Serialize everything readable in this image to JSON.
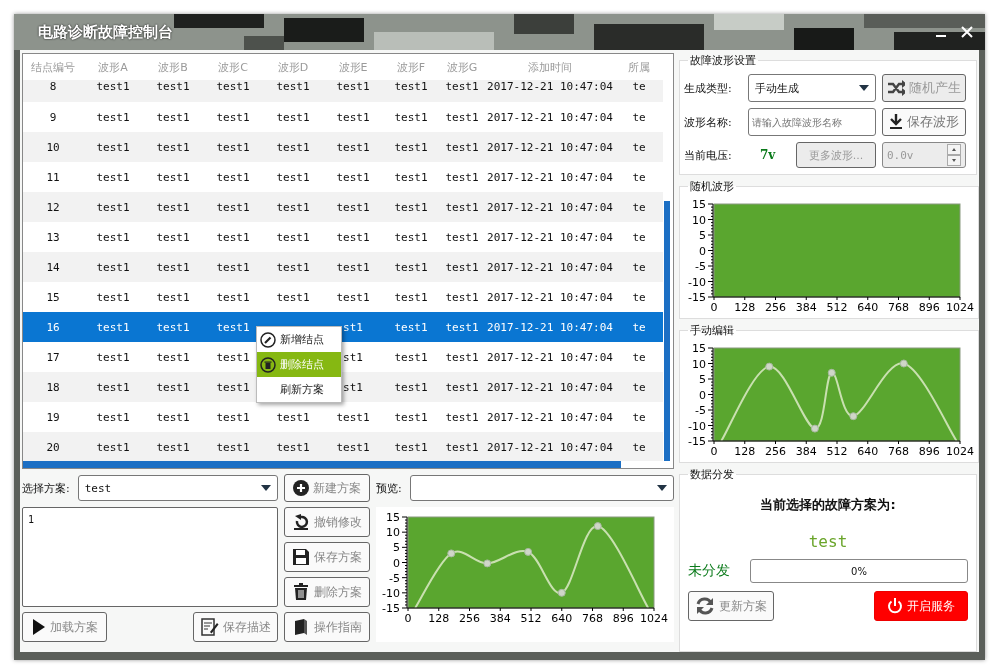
{
  "window": {
    "title": "电路诊断故障控制台"
  },
  "table": {
    "columns": [
      "结点编号",
      "波形A",
      "波形B",
      "波形C",
      "波形D",
      "波形E",
      "波形F",
      "波形G",
      "添加时间",
      "所属"
    ],
    "rows": [
      {
        "cells": [
          "8",
          "test1",
          "test1",
          "test1",
          "test1",
          "test1",
          "test1",
          "test1",
          "2017-12-21 10:47:04",
          "te"
        ],
        "selected": false
      },
      {
        "cells": [
          "9",
          "test1",
          "test1",
          "test1",
          "test1",
          "test1",
          "test1",
          "test1",
          "2017-12-21 10:47:04",
          "te"
        ],
        "selected": false
      },
      {
        "cells": [
          "10",
          "test1",
          "test1",
          "test1",
          "test1",
          "test1",
          "test1",
          "test1",
          "2017-12-21 10:47:04",
          "te"
        ],
        "selected": false
      },
      {
        "cells": [
          "11",
          "test1",
          "test1",
          "test1",
          "test1",
          "test1",
          "test1",
          "test1",
          "2017-12-21 10:47:04",
          "te"
        ],
        "selected": false
      },
      {
        "cells": [
          "12",
          "test1",
          "test1",
          "test1",
          "test1",
          "test1",
          "test1",
          "test1",
          "2017-12-21 10:47:04",
          "te"
        ],
        "selected": false
      },
      {
        "cells": [
          "13",
          "test1",
          "test1",
          "test1",
          "test1",
          "test1",
          "test1",
          "test1",
          "2017-12-21 10:47:04",
          "te"
        ],
        "selected": false
      },
      {
        "cells": [
          "14",
          "test1",
          "test1",
          "test1",
          "test1",
          "test1",
          "test1",
          "test1",
          "2017-12-21 10:47:04",
          "te"
        ],
        "selected": false
      },
      {
        "cells": [
          "15",
          "test1",
          "test1",
          "test1",
          "test1",
          "test1",
          "test1",
          "test1",
          "2017-12-21 10:47:04",
          "te"
        ],
        "selected": false
      },
      {
        "cells": [
          "16",
          "test1",
          "test1",
          "test1",
          null,
          "st1",
          "test1",
          "test1",
          "2017-12-21 10:47:04",
          "te"
        ],
        "selected": true
      },
      {
        "cells": [
          "17",
          "test1",
          "test1",
          "test1",
          null,
          "st1",
          "test1",
          "test1",
          "2017-12-21 10:47:04",
          "te"
        ],
        "selected": false
      },
      {
        "cells": [
          "18",
          "test1",
          "test1",
          "test1",
          null,
          "st1",
          "test1",
          "test1",
          "2017-12-21 10:47:04",
          "te"
        ],
        "selected": false
      },
      {
        "cells": [
          "19",
          "test1",
          "test1",
          "test1",
          "test1",
          "test1",
          "test1",
          "test1",
          "2017-12-21 10:47:04",
          "te"
        ],
        "selected": false
      },
      {
        "cells": [
          "20",
          "test1",
          "test1",
          "test1",
          "test1",
          "test1",
          "test1",
          "test1",
          "2017-12-21 10:47:04",
          "te"
        ],
        "selected": false
      }
    ]
  },
  "context_menu": {
    "items": [
      {
        "label": "新增结点",
        "kind": "edit",
        "selected": false
      },
      {
        "label": "删除结点",
        "kind": "delete",
        "selected": true
      },
      {
        "label": "刷新方案",
        "kind": "plain",
        "selected": false
      }
    ]
  },
  "scheme": {
    "label": "选择方案:",
    "value": "test",
    "new_button": "新建方案",
    "description": "1",
    "buttons": [
      {
        "label": "撤销修改",
        "kind": "undo"
      },
      {
        "label": "保存方案",
        "kind": "save"
      },
      {
        "label": "删除方案",
        "kind": "delete"
      },
      {
        "label": "操作指南",
        "kind": "guide"
      }
    ],
    "load_button": "加载方案",
    "save_description_button": "保存描述"
  },
  "preview": {
    "label": "预览:",
    "chart_data": {
      "type": "line",
      "x": [
        30,
        180,
        330,
        500,
        640,
        790,
        1000
      ],
      "series": [
        {
          "color": "#c9e0b0",
          "values": [
            -15,
            3,
            -0.3,
            3.5,
            -10,
            12,
            -15
          ]
        }
      ],
      "xlim": [
        0,
        1024
      ],
      "ylim": [
        -15,
        15
      ],
      "xticks": [
        0,
        128,
        256,
        384,
        512,
        640,
        768,
        896,
        1024
      ],
      "yticks": [
        -15,
        -10,
        -5,
        0,
        5,
        10,
        15
      ]
    }
  },
  "settings": {
    "title": "故障波形设置",
    "type_label": "生成类型:",
    "type_value": "手动生成",
    "random_button": {
      "label": "随机产生",
      "disabled": true
    },
    "name_label": "波形名称:",
    "name_placeholder": "请输入故障波形名称",
    "save_button": {
      "label": "保存波形",
      "disabled": false
    },
    "voltage_label": "当前电压:",
    "voltage_value": "7v",
    "more_button": {
      "label": "更多波形...",
      "disabled": true
    },
    "spin": {
      "value": "0.0v",
      "disabled": true
    }
  },
  "random_wave": {
    "title": "随机波形",
    "chart_data": {
      "type": "line",
      "xlim": [
        0,
        1024
      ],
      "ylim": [
        -15,
        15
      ],
      "xticks": [
        0,
        128,
        256,
        384,
        512,
        640,
        768,
        896,
        1024
      ],
      "yticks": [
        -15,
        -10,
        -5,
        0,
        5,
        10,
        15
      ]
    }
  },
  "manual_edit": {
    "title": "手动编辑",
    "chart_data": {
      "type": "line",
      "x": [
        30,
        230,
        420,
        490,
        580,
        790,
        1010
      ],
      "series": [
        {
          "color": "#c9e0b0",
          "values": [
            -15,
            9,
            -11,
            7,
            -7,
            10,
            -15
          ]
        }
      ],
      "xlim": [
        0,
        1024
      ],
      "ylim": [
        -15,
        15
      ],
      "xticks": [
        0,
        128,
        256,
        384,
        512,
        640,
        768,
        896,
        1024
      ],
      "yticks": [
        -15,
        -10,
        -5,
        0,
        5,
        10,
        15
      ]
    }
  },
  "distribution": {
    "title": "数据分发",
    "heading": "当前选择的故障方案为:",
    "scheme": "test",
    "status": "未分发",
    "progress": {
      "level": 0,
      "reading": "0%"
    },
    "update_button": "更新方案",
    "start_button": "开启服务"
  }
}
